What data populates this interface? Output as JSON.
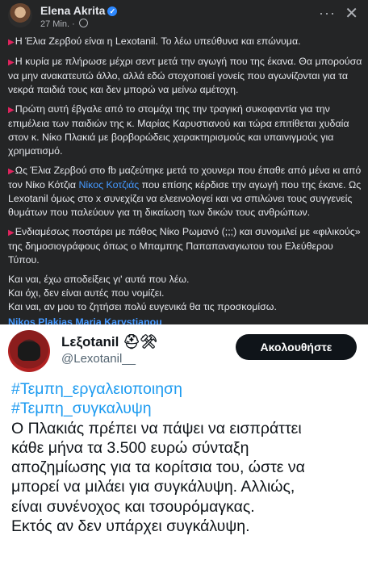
{
  "facebook": {
    "author": "Elena Akrita",
    "time": "27 Min.",
    "time_sep": "·",
    "more_icon": "more-icon",
    "close_icon": "close-icon",
    "p1": "Η Έλια Ζερβού είναι η Lexotanil. Το λέω υπεύθυνα και επώνυμα.",
    "p2": "Η κυρία με πλήρωσε μέχρι σεντ μετά την αγωγή που της έκανα. Θα μπορούσα να μην ανακατευτώ άλλο, αλλά εδώ στοχοποιεί γονείς που αγωνίζονται για τα νεκρά παιδιά τους και δεν μπορώ να μείνω αμέτοχη.",
    "p3": "Πρώτη αυτή έβγαλε από το στομάχι της την τραγική συκοφαντία για την επιμέλεια των παιδιών της κ. Μαρίας Καρυστιανού και τώρα επιτίθεται χυδαία στον κ. Νίκο Πλακιά με βορβορώδεις χαρακτηρισμούς και υπαινιγμούς για χρηματισμό.",
    "p4_a": "Ως Έλια Ζερβού στο fb μαζεύτηκε μετά το χουνερι που έπαθε από μένα κι από τον Νίκο Κότζια ",
    "p4_link": "Νίκος Κοτζιάς",
    "p4_b": " που επίσης κέρδισε την αγωγή που της έκανε. Ως Lexotanil όμως στο x συνεχίζει να ελεεινολογεί και να σπιλώνει τους συγγενείς θυμάτων που παλεύουν για τη δικαίωση των δικών τους ανθρώπων.",
    "p5": "Ενδιαμέσως ποστάρει με πάθος Νίκο Ρωμανό (;;;) και συνομιλεί με «φιλικούς» της δημοσιογράφους όπως ο Μπαμπης Παπαπαναγιωτου του Ελεύθερου Τύπου.",
    "l1": "Και ναι, έχω αποδείξεις γι' αυτά που λέω.",
    "l2": "Και όχι, δεν είναι αυτές που νομίζει.",
    "l3": "Και ναι, αν μου το ζητήσει πολύ ευγενικά θα τις προσκομίσω.",
    "tag1": "Nikos Plakias",
    "tag2": "Maria Karystianou"
  },
  "tweet": {
    "name": "Lεξotanil",
    "name_emojis": "⛑⚒",
    "handle": "@Lexotanil__",
    "follow_label": "Ακολουθήστε",
    "hashtag1": "#Τεμπη_εργαλειοποιηση",
    "hashtag2": "#Τεμπη_συγκαλυψη",
    "text_lines": [
      "Ο Πλακιάς πρέπει να πάψει να εισπράττει",
      "κάθε μήνα τα 3.500 ευρώ σύνταξη",
      "αποζημίωσης για τα κορίτσια του, ώστε να",
      "μπορεί να μιλάει για συγκάλυψη. Αλλιώς,",
      "είναι συνένοχος και τσουρόμαγκας.",
      "Εκτός αν δεν υπάρχει συγκάλυψη."
    ]
  }
}
